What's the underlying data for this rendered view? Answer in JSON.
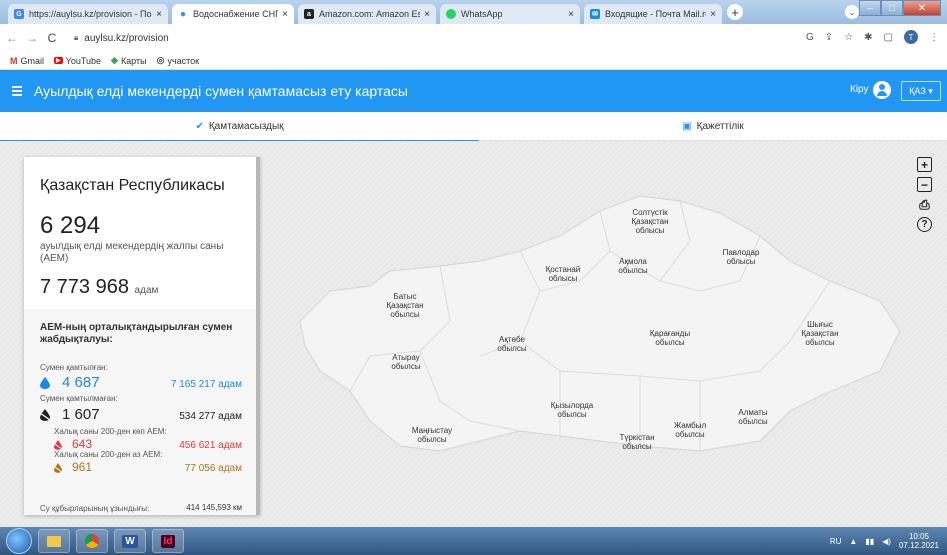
{
  "browser": {
    "tabs": [
      {
        "title": "https://auylsu.kz/provision - Пои",
        "fav_color": "#4285f4",
        "fav_glyph": "G",
        "active": false
      },
      {
        "title": "Водоснабжение СНП",
        "fav_color": "#2296f3",
        "fav_glyph": "●",
        "active": true
      },
      {
        "title": "Amazon.com: Amazon Essentials",
        "fav_color": "#222222",
        "fav_glyph": "a",
        "active": false
      },
      {
        "title": "WhatsApp",
        "fav_color": "#25d366",
        "fav_glyph": "●",
        "active": false
      },
      {
        "title": "Входящие - Почта Mail.ru",
        "fav_color": "#168de2",
        "fav_glyph": "✉",
        "active": false
      }
    ],
    "new_tab": "+",
    "url": "auylsu.kz/provision",
    "bookmarks": [
      {
        "label": "Gmail",
        "icon": "M",
        "color": "#d93025"
      },
      {
        "label": "YouTube",
        "icon": "▶",
        "color": "#ff0000"
      },
      {
        "label": "Карты",
        "icon": "◆",
        "color": "#34a853"
      },
      {
        "label": "участок",
        "icon": "◎",
        "color": "#555555"
      }
    ]
  },
  "app": {
    "title": "Ауылдық елді мекендерді сумен қамтамасыз ету картасы",
    "login": "Кіру",
    "language": "ҚАЗ ▾",
    "tabs": [
      {
        "label": "Қамтамасыздық",
        "icon": "check-circle-icon",
        "active": true
      },
      {
        "label": "Қажеттілік",
        "icon": "calendar-icon",
        "active": false
      }
    ]
  },
  "panel": {
    "title": "Қазақстан Республикасы",
    "settlements_count": "6 294",
    "settlements_label": "ауылдық елді мекендердің жалпы саны (АЕМ)",
    "population": "7 773 968",
    "population_unit": "адам",
    "section_title": "АЕМ-ның орталықтандырылған сумен жабдықталуы:",
    "provided_label": "Сумен қамтылған:",
    "provided_count": "4 687",
    "provided_people": "7 165 217 адам",
    "not_provided_label": "Сумен қамтылмаған:",
    "not_provided_count": "1 607",
    "not_provided_people": "534 277 адам",
    "over200_label": "Халық саны 200-ден көп АЕМ:",
    "over200_count": "643",
    "over200_people": "456 621 адам",
    "under200_label": "Халық саны 200-ден аз АЕМ:",
    "under200_count": "961",
    "under200_people": "77 056 адам",
    "pipes_label": "Су құбырларының ұзындығы:",
    "pipes_value": "414 145,593 км"
  },
  "map": {
    "regions": [
      {
        "name": "Солтүстік\nҚазақстан\nоблысы"
      },
      {
        "name": "Павлодар\nоблысы"
      },
      {
        "name": "Қостанай\nоблысы"
      },
      {
        "name": "Ақмола\nобылсы"
      },
      {
        "name": "Батыс\nҚазақстан\nобылсы"
      },
      {
        "name": "Шығыс\nҚазақстан\nобылсы"
      },
      {
        "name": "Ақтөбе\nобылсы"
      },
      {
        "name": "Қарағанды\nобылсы"
      },
      {
        "name": "Атырау\nобылсы"
      },
      {
        "name": "Қызылорда\nобылсы"
      },
      {
        "name": "Маңғыстау\nобылсы"
      },
      {
        "name": "Алматы\nобылсы"
      },
      {
        "name": "Жамбыл\nобылсы"
      },
      {
        "name": "Түркістан\nобылсы"
      }
    ],
    "tools": [
      "+",
      "−",
      "⎙",
      "?"
    ]
  },
  "taskbar": {
    "apps": [
      "",
      "C",
      "W",
      "Id"
    ],
    "lang": "RU",
    "time": "10:05",
    "date": "07.12.2021"
  },
  "colors": {
    "accent": "#2296f3",
    "provided": "#1e88e5",
    "not_provided": "#222222",
    "over200": "#e53935",
    "under200": "#a5791a"
  }
}
